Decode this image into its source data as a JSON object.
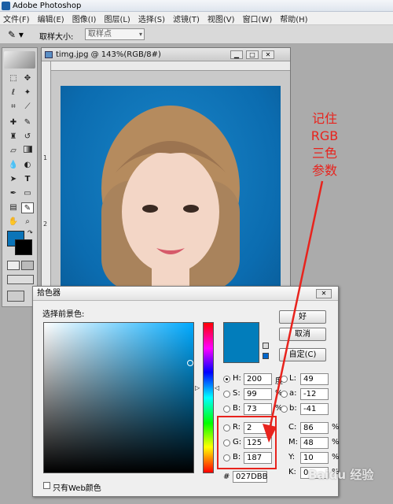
{
  "app": {
    "title": "Adobe Photoshop"
  },
  "menu": [
    "文件(F)",
    "编辑(E)",
    "图像(I)",
    "图层(L)",
    "选择(S)",
    "滤镜(T)",
    "视图(V)",
    "窗口(W)",
    "帮助(H)"
  ],
  "options": {
    "sample_size_label": "取样大小:",
    "sample_size_value": "取样点"
  },
  "document": {
    "title": "timg.jpg @ 143%(RGB/8#)",
    "ruler_marks": [
      "1",
      "2"
    ]
  },
  "picker": {
    "title": "拾色器",
    "select_label": "选择前景色:",
    "ok": "好",
    "cancel": "取消",
    "custom": "自定(C)",
    "web_only": "只有Web颜色",
    "hsb": [
      {
        "label": "H:",
        "value": "200",
        "unit": "度"
      },
      {
        "label": "S:",
        "value": "99",
        "unit": "%"
      },
      {
        "label": "B:",
        "value": "73",
        "unit": "%"
      }
    ],
    "rgb": [
      {
        "label": "R:",
        "value": "2"
      },
      {
        "label": "G:",
        "value": "125"
      },
      {
        "label": "B:",
        "value": "187"
      }
    ],
    "lab": [
      {
        "label": "L:",
        "value": "49"
      },
      {
        "label": "a:",
        "value": "-12"
      },
      {
        "label": "b:",
        "value": "-41"
      }
    ],
    "cmyk": [
      {
        "label": "C:",
        "value": "86",
        "unit": "%"
      },
      {
        "label": "M:",
        "value": "48",
        "unit": "%"
      },
      {
        "label": "Y:",
        "value": "10",
        "unit": "%"
      },
      {
        "label": "K:",
        "value": "0",
        "unit": "%"
      }
    ],
    "hex_label": "#",
    "hex_value": "027DBB",
    "current_color": "#027DBB"
  },
  "annotation": {
    "lines": [
      "记住",
      "RGB",
      "三色",
      "参数"
    ],
    "color": "#e8231d"
  },
  "watermark": "Baidu 经验"
}
